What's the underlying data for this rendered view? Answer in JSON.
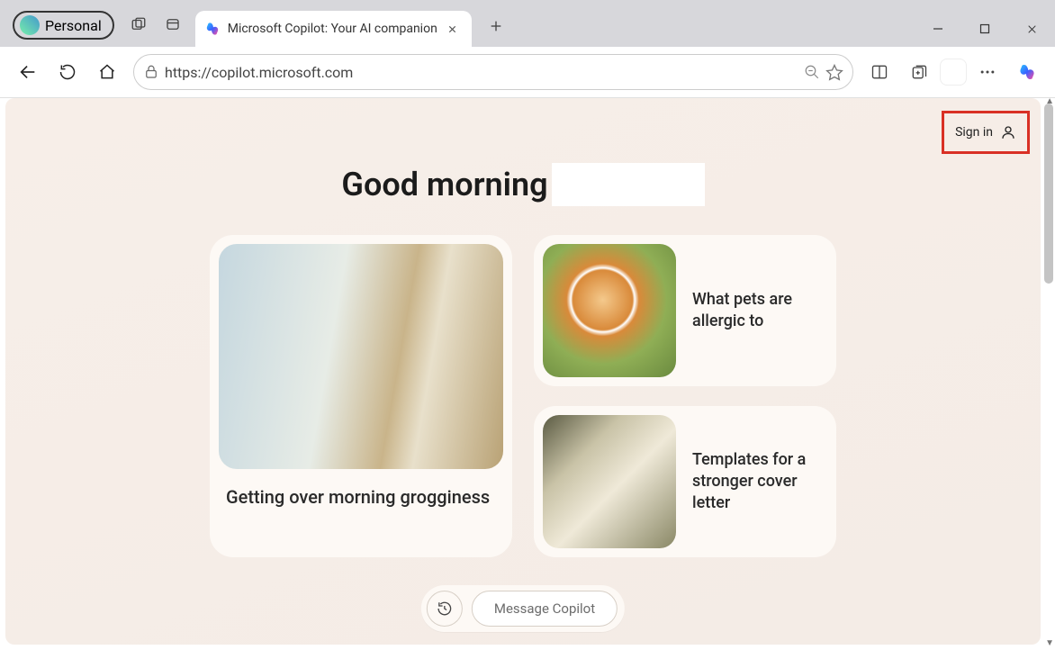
{
  "window": {
    "profile_label": "Personal",
    "tab_title": "Microsoft Copilot: Your AI companion",
    "url": "https://copilot.microsoft.com"
  },
  "page": {
    "sign_in_label": "Sign in",
    "greeting": "Good morning",
    "cards": {
      "large": {
        "title": "Getting over morning grogginess"
      },
      "small": [
        {
          "title": "What pets are allergic to"
        },
        {
          "title": "Templates for a stronger cover letter"
        }
      ]
    },
    "composer": {
      "placeholder": "Message Copilot"
    }
  }
}
